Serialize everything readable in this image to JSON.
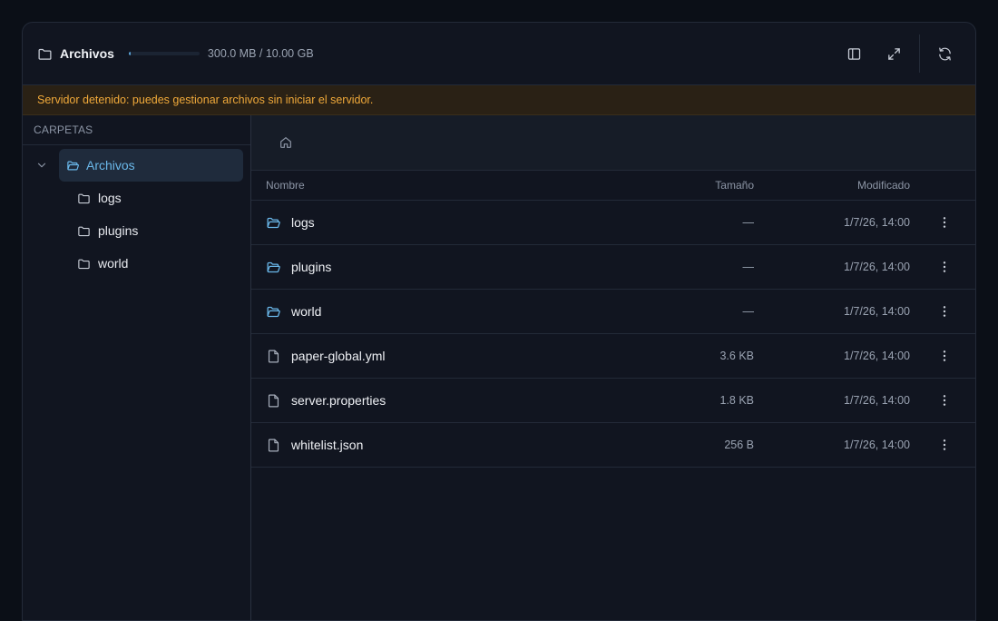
{
  "header": {
    "title": "Archivos",
    "usage_text": "300.0 MB / 10.00 GB",
    "usage_fraction": 0.03
  },
  "banner": {
    "text": "Servidor detenido: puedes gestionar archivos sin iniciar el servidor."
  },
  "sidebar": {
    "heading": "CARPETAS",
    "root": "Archivos",
    "children": [
      "logs",
      "plugins",
      "world"
    ]
  },
  "table": {
    "columns": {
      "name": "Nombre",
      "size": "Tamaño",
      "modified": "Modificado"
    },
    "rows": [
      {
        "name": "logs",
        "type": "folder",
        "size": "—",
        "modified": "1/7/26, 14:00"
      },
      {
        "name": "plugins",
        "type": "folder",
        "size": "—",
        "modified": "1/7/26, 14:00"
      },
      {
        "name": "world",
        "type": "folder",
        "size": "—",
        "modified": "1/7/26, 14:00"
      },
      {
        "name": "paper-global.yml",
        "type": "file",
        "size": "3.6 KB",
        "modified": "1/7/26, 14:00"
      },
      {
        "name": "server.properties",
        "type": "file",
        "size": "1.8 KB",
        "modified": "1/7/26, 14:00"
      },
      {
        "name": "whitelist.json",
        "type": "file",
        "size": "256 B",
        "modified": "1/7/26, 14:00"
      }
    ]
  },
  "icons": {
    "header": "folder-icon",
    "toggle_sidebar": "sidebar-panel-icon",
    "fullscreen": "expand-icon",
    "refresh": "refresh-icon",
    "home": "home-icon",
    "folder": "folder-open-icon",
    "file": "file-icon",
    "more": "more-vertical-icon"
  },
  "colors": {
    "accent": "#6ab8ea",
    "warning_text": "#f0a93a",
    "warning_bg": "#2a2115"
  }
}
